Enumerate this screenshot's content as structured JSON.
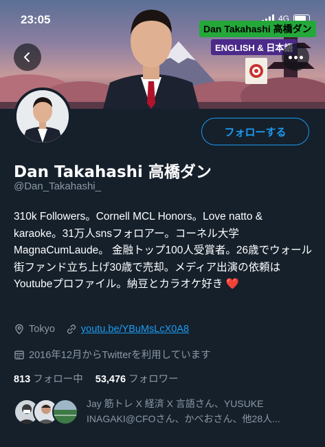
{
  "status_bar": {
    "time": "23:05",
    "network": "4G"
  },
  "banner": {
    "name_tag": "Dan Takahashi 高橋ダン",
    "language_tag": "ENGLISH & 日本語"
  },
  "profile": {
    "follow_label": "フォローする",
    "display_name": "Dan Takahashi 高橋ダン",
    "handle": "@Dan_Takahashi_",
    "bio": "310k Followers。Cornell MCL Honors。Love natto & karaoke。31万人snsフォロアー。コーネル大学MagnaCumLaude。 金融トップ100人受賞者。26歳でウォール街ファンド立ち上げ30歳で売却。メディア出演の依頼はYoutubeプロファイル。納豆とカラオケ好き",
    "bio_emoji": "❤️",
    "location": "Tokyo",
    "link": "youtu.be/YBuMsLcX0A8",
    "joined": "2016年12月からTwitterを利用しています",
    "following_count": "813",
    "following_label": "フォロー中",
    "followers_count": "53,476",
    "followers_label": "フォロワー",
    "followed_by": "Jay 筋トレ X 経済 X 言語さん、YUSUKE INAGAKI@CFOさん、かべおさん、他28人..."
  },
  "colors": {
    "background": "#15202b",
    "accent": "#1d9bf0",
    "secondary_text": "#8b98a5",
    "name_tag_bg": "#24a83a",
    "language_tag_bg": "#4b2a8a"
  },
  "icons": [
    "back-arrow-icon",
    "more-icon",
    "location-pin-icon",
    "link-icon",
    "calendar-icon",
    "heart-emoji"
  ]
}
